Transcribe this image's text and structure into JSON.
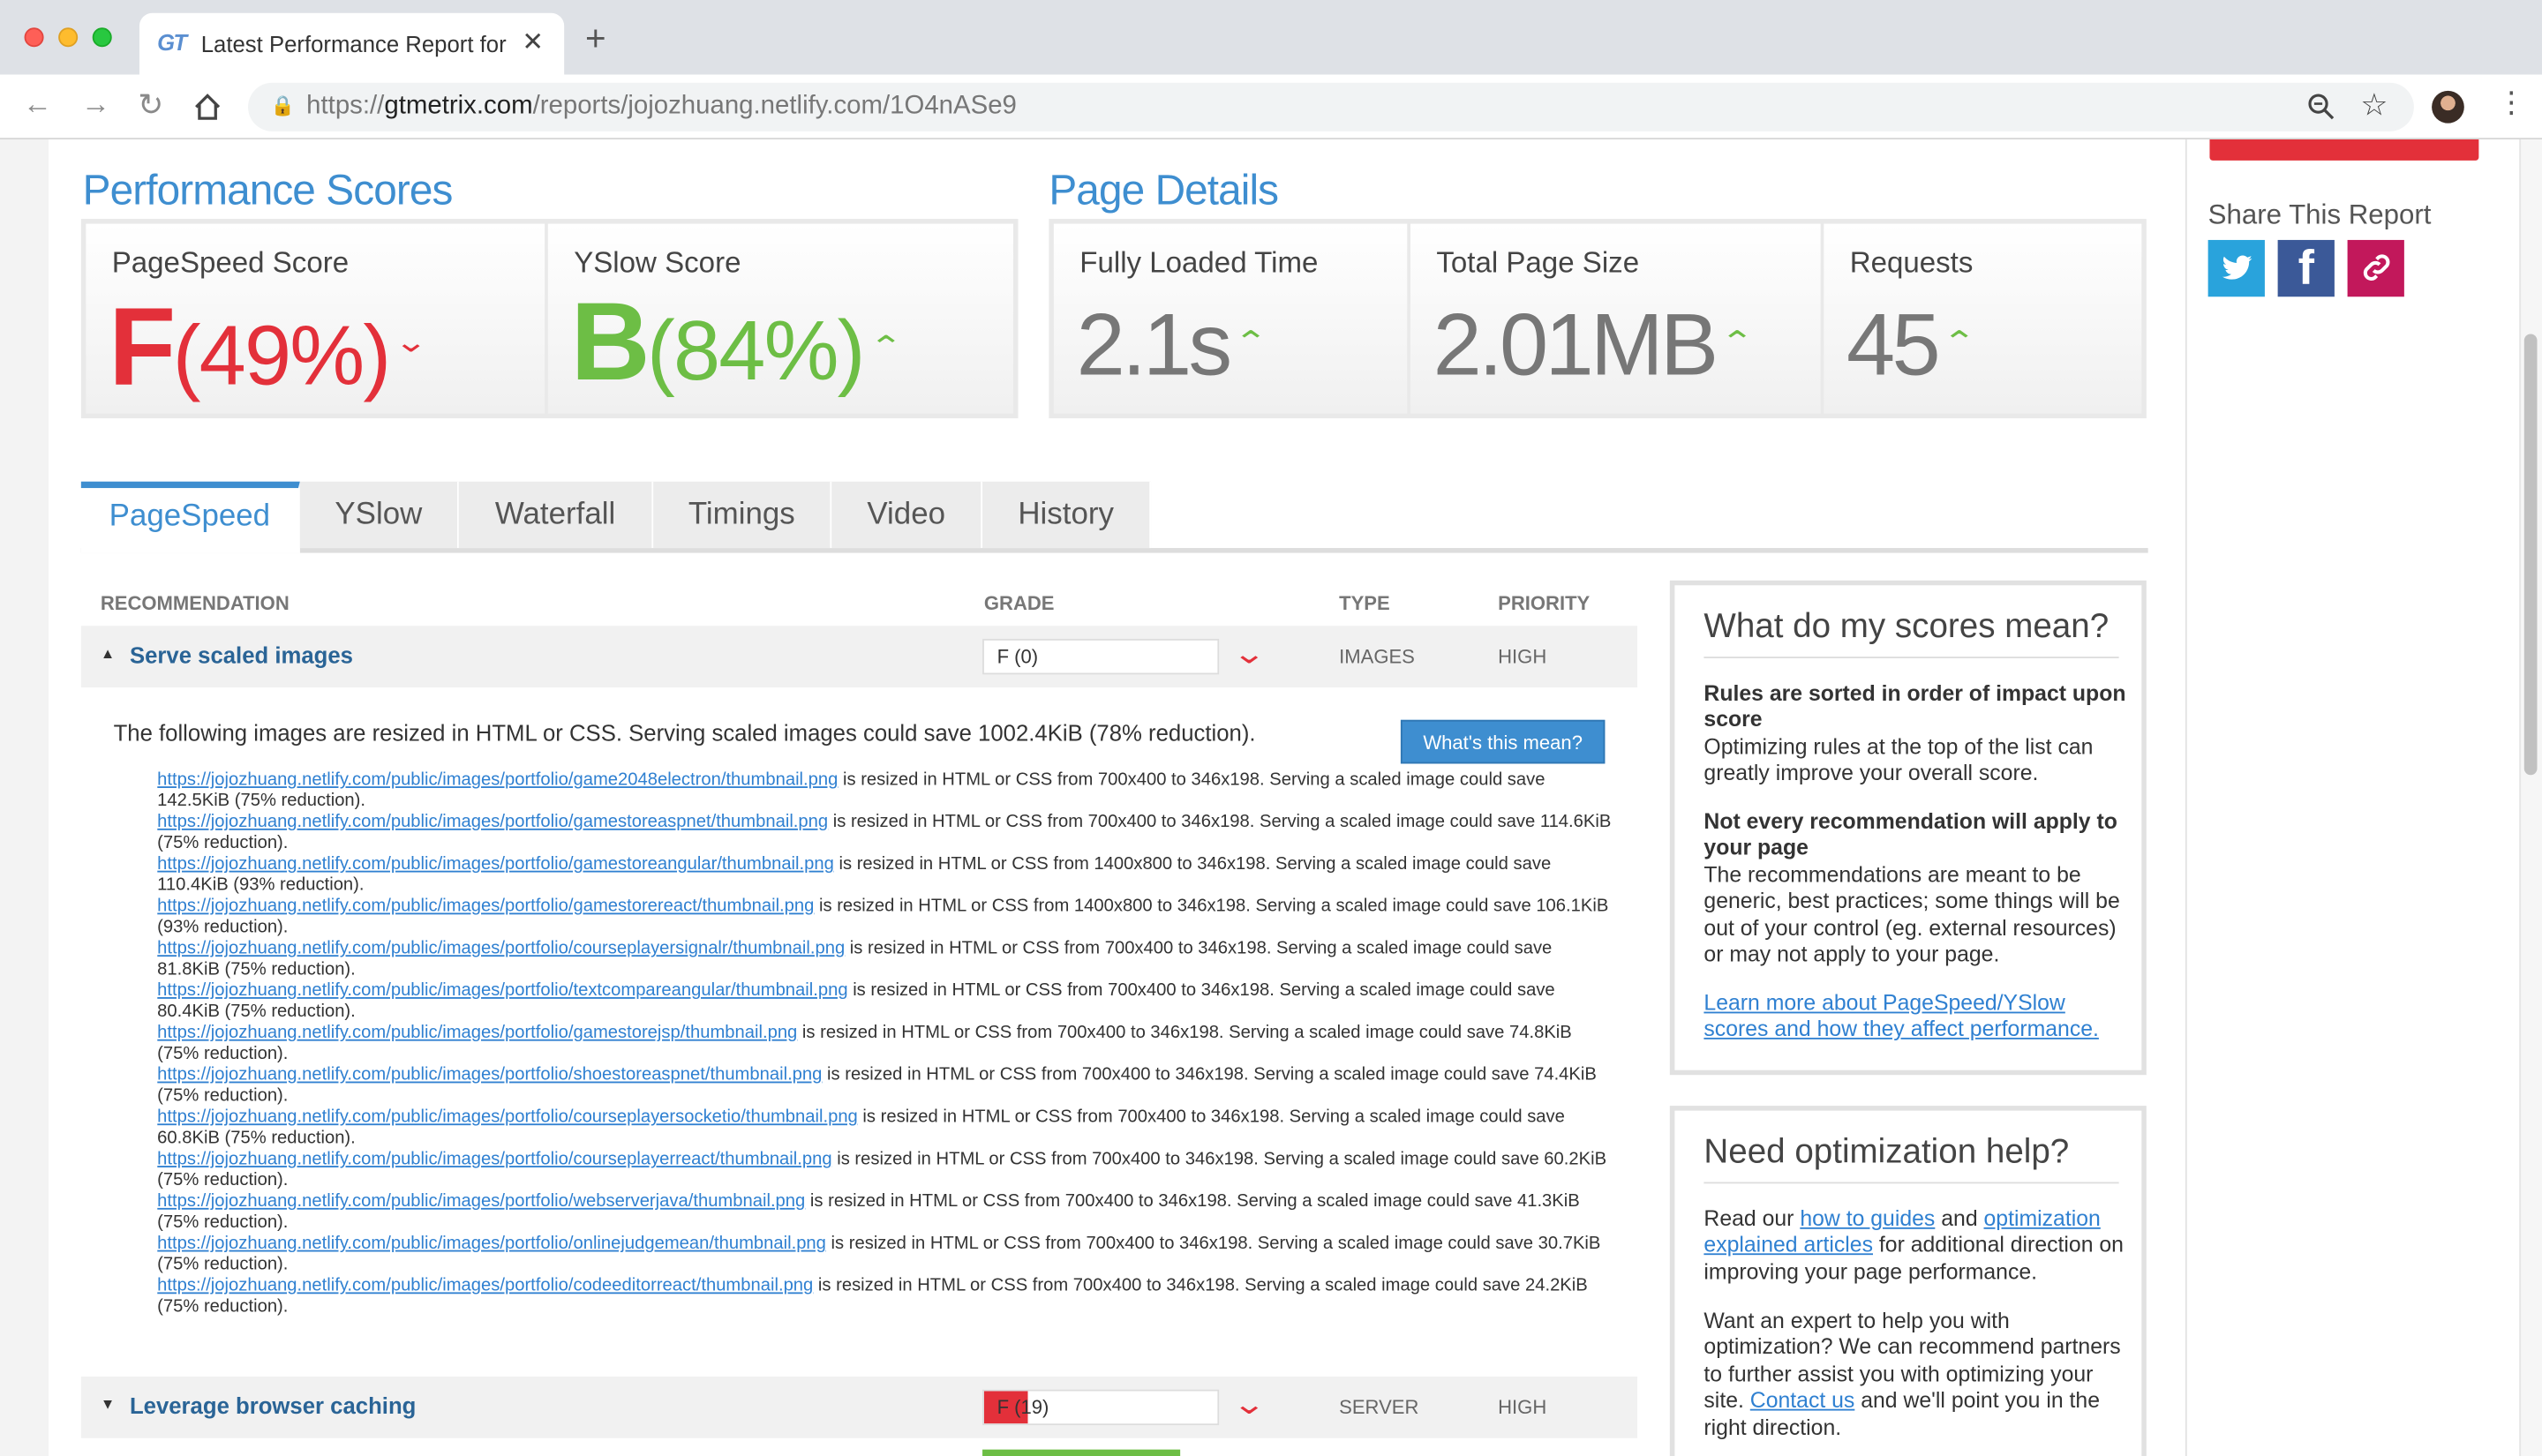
{
  "browser": {
    "tab_title": "Latest Performance Report for",
    "favicon_text": "GT",
    "url_scheme": "https://",
    "url_host": "gtmetrix.com",
    "url_path": "/reports/jojozhuang.netlify.com/1O4nASe9"
  },
  "performance": {
    "title": "Performance Scores",
    "pagespeed": {
      "label": "PageSpeed Score",
      "grade": "F",
      "percent": "(49%)",
      "trend": "down"
    },
    "yslow": {
      "label": "YSlow Score",
      "grade": "B",
      "percent": "(84%)",
      "trend": "up"
    }
  },
  "details": {
    "title": "Page Details",
    "fully_loaded": {
      "label": "Fully Loaded Time",
      "value": "2.1s"
    },
    "page_size": {
      "label": "Total Page Size",
      "value": "2.01MB"
    },
    "requests": {
      "label": "Requests",
      "value": "45"
    }
  },
  "share": {
    "title": "Share This Report"
  },
  "tabs": [
    "PageSpeed",
    "YSlow",
    "Waterfall",
    "Timings",
    "Video",
    "History"
  ],
  "table_headers": {
    "recommendation": "RECOMMENDATION",
    "grade": "GRADE",
    "type": "TYPE",
    "priority": "PRIORITY"
  },
  "recommendations": [
    {
      "title": "Serve scaled images",
      "grade": "F (0)",
      "score": 0,
      "type": "IMAGES",
      "priority": "HIGH",
      "expanded": true
    },
    {
      "title": "Leverage browser caching",
      "grade": "F (19)",
      "score": 19,
      "type": "SERVER",
      "priority": "HIGH",
      "expanded": false
    }
  ],
  "detail": {
    "summary": "The following images are resized in HTML or CSS. Serving scaled images could save 1002.4KiB (78% reduction).",
    "button": "What's this mean?",
    "items": [
      {
        "url": "https://jojozhuang.netlify.com/public/images/portfolio/game2048electron/thumbnail.png",
        "text": " is resized in HTML or CSS from 700x400 to 346x198. Serving a scaled image could save 142.5KiB (75% reduction)."
      },
      {
        "url": "https://jojozhuang.netlify.com/public/images/portfolio/gamestoreaspnet/thumbnail.png",
        "text": " is resized in HTML or CSS from 700x400 to 346x198. Serving a scaled image could save 114.6KiB (75% reduction)."
      },
      {
        "url": "https://jojozhuang.netlify.com/public/images/portfolio/gamestoreangular/thumbnail.png",
        "text": " is resized in HTML or CSS from 1400x800 to 346x198. Serving a scaled image could save 110.4KiB (93% reduction)."
      },
      {
        "url": "https://jojozhuang.netlify.com/public/images/portfolio/gamestorereact/thumbnail.png",
        "text": " is resized in HTML or CSS from 1400x800 to 346x198. Serving a scaled image could save 106.1KiB (93% reduction)."
      },
      {
        "url": "https://jojozhuang.netlify.com/public/images/portfolio/courseplayersignalr/thumbnail.png",
        "text": " is resized in HTML or CSS from 700x400 to 346x198. Serving a scaled image could save 81.8KiB (75% reduction)."
      },
      {
        "url": "https://jojozhuang.netlify.com/public/images/portfolio/textcompareangular/thumbnail.png",
        "text": " is resized in HTML or CSS from 700x400 to 346x198. Serving a scaled image could save 80.4KiB (75% reduction)."
      },
      {
        "url": "https://jojozhuang.netlify.com/public/images/portfolio/gamestorejsp/thumbnail.png",
        "text": " is resized in HTML or CSS from 700x400 to 346x198. Serving a scaled image could save 74.8KiB (75% reduction)."
      },
      {
        "url": "https://jojozhuang.netlify.com/public/images/portfolio/shoestoreaspnet/thumbnail.png",
        "text": " is resized in HTML or CSS from 700x400 to 346x198. Serving a scaled image could save 74.4KiB (75% reduction)."
      },
      {
        "url": "https://jojozhuang.netlify.com/public/images/portfolio/courseplayersocketio/thumbnail.png",
        "text": " is resized in HTML or CSS from 700x400 to 346x198. Serving a scaled image could save 60.8KiB (75% reduction)."
      },
      {
        "url": "https://jojozhuang.netlify.com/public/images/portfolio/courseplayerreact/thumbnail.png",
        "text": " is resized in HTML or CSS from 700x400 to 346x198. Serving a scaled image could save 60.2KiB (75% reduction)."
      },
      {
        "url": "https://jojozhuang.netlify.com/public/images/portfolio/webserverjava/thumbnail.png",
        "text": " is resized in HTML or CSS from 700x400 to 346x198. Serving a scaled image could save 41.3KiB (75% reduction)."
      },
      {
        "url": "https://jojozhuang.netlify.com/public/images/portfolio/onlinejudgemean/thumbnail.png",
        "text": " is resized in HTML or CSS from 700x400 to 346x198. Serving a scaled image could save 30.7KiB (75% reduction)."
      },
      {
        "url": "https://jojozhuang.netlify.com/public/images/portfolio/codeeditorreact/thumbnail.png",
        "text": " is resized in HTML or CSS from 700x400 to 346x198. Serving a scaled image could save 24.2KiB (75% reduction)."
      }
    ]
  },
  "scores_box": {
    "title": "What do my scores mean?",
    "h1": "Rules are sorted in order of impact upon score",
    "p1": "Optimizing rules at the top of the list can greatly improve your overall score.",
    "h2": "Not every recommendation will apply to your page",
    "p2": "The recommendations are meant to be generic, best practices; some things will be out of your control (eg. external resources) or may not apply to your page.",
    "link": "Learn more about PageSpeed/YSlow scores and how they affect performance."
  },
  "help_box": {
    "title": "Need optimization help?",
    "p1_pre": "Read our ",
    "guides": "how to guides",
    "p1_mid": " and ",
    "articles": "optimization explained articles",
    "p1_post": " for additional direction on improving your page performance.",
    "p2_pre": "Want an expert to help you with optimization? We can recommend partners to further assist you with optimizing your site. ",
    "contact": "Contact us",
    "p2_post": " and we'll point you in the right direction."
  },
  "colors": {
    "accent": "#3e8ed0",
    "bad": "#e3303a",
    "good": "#6dbe45"
  },
  "icons": [
    "back-icon",
    "forward-icon",
    "reload-icon",
    "home-icon",
    "lock-icon",
    "zoom-icon",
    "star-icon",
    "menu-icon",
    "twitter-icon",
    "facebook-icon",
    "link-icon"
  ]
}
